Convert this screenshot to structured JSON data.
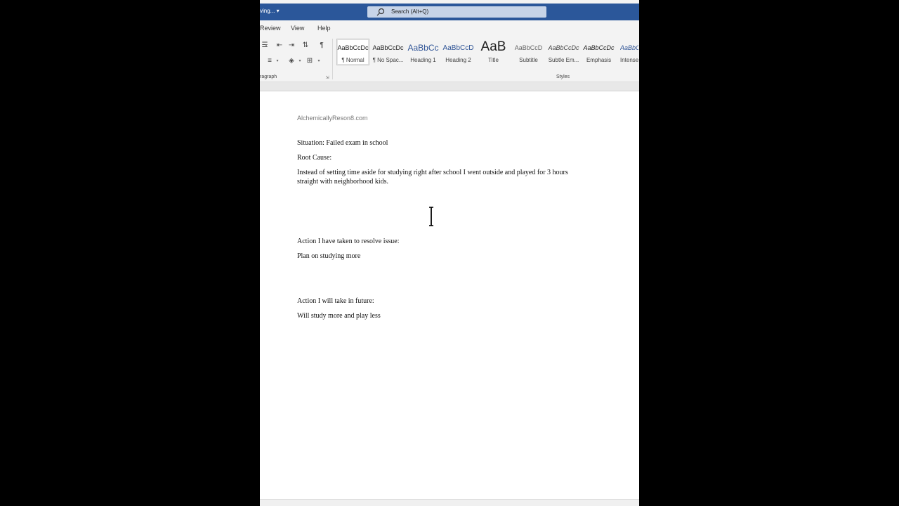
{
  "titlebar": {
    "saving_text": "ving... ▾",
    "search_text": "Search (Alt+Q)"
  },
  "tabs": [
    {
      "label": "Review"
    },
    {
      "label": "View"
    },
    {
      "label": "Help"
    }
  ],
  "ribbon": {
    "paragraph_label": "ragraph",
    "styles_label": "Styles",
    "styles": [
      {
        "preview": "AaBbCcDc",
        "name": "¶ Normal"
      },
      {
        "preview": "AaBbCcDc",
        "name": "¶ No Spac..."
      },
      {
        "preview": "AaBbCc",
        "name": "Heading 1"
      },
      {
        "preview": "AaBbCcD",
        "name": "Heading 2"
      },
      {
        "preview": "AaB",
        "name": "Title"
      },
      {
        "preview": "AaBbCcD",
        "name": "Subtitle"
      },
      {
        "preview": "AaBbCcDc",
        "name": "Subtle Em..."
      },
      {
        "preview": "AaBbCcDc",
        "name": "Emphasis"
      },
      {
        "preview": "AaBbCc",
        "name": "Intense"
      }
    ]
  },
  "document": {
    "header": "AlchemicallyReson8.com",
    "situation": "Situation: Failed exam in school",
    "root_cause_label": "Root Cause:",
    "root_cause_line1": "Instead of setting time aside for studying right after school I went outside and played for 3 hours",
    "root_cause_line2": "straight with neighborhood kids.",
    "action_taken_label": "Action I have taken to resolve issue:",
    "action_taken": "Plan on studying more",
    "action_future_label": "Action I will take in future:",
    "action_future": "Will study more and play less"
  },
  "colors": {
    "titlebar": "#2b579a",
    "accent_heading": "#2f5496"
  }
}
